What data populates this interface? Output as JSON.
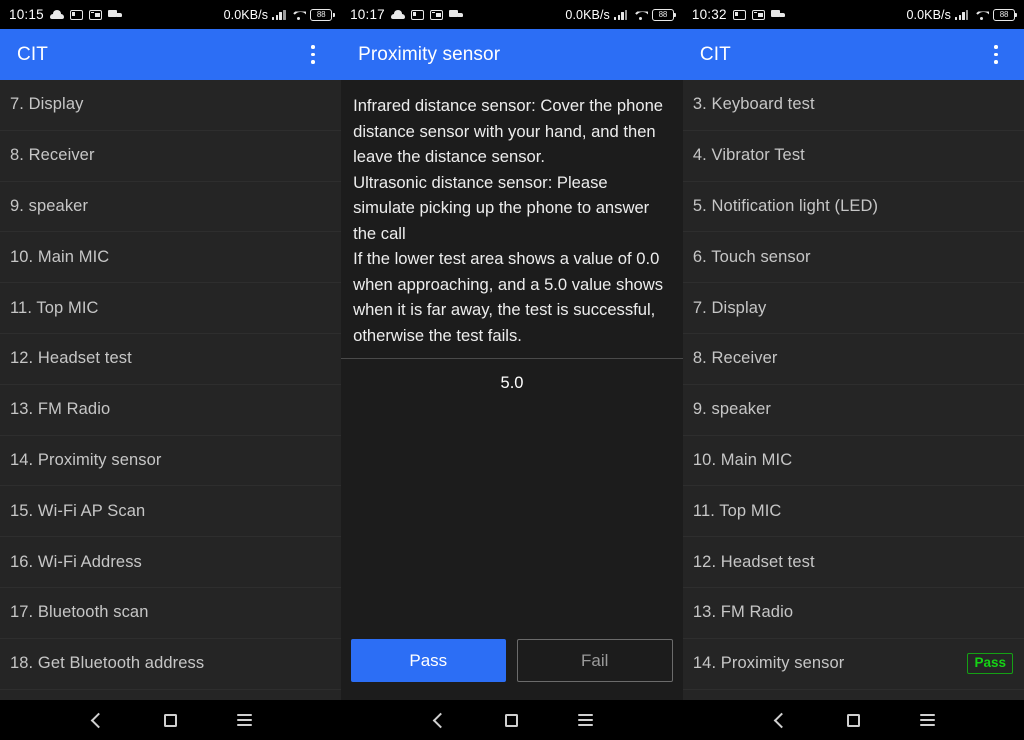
{
  "panels": {
    "left": {
      "statusbar": {
        "time": "10:15",
        "network_speed": "0.0KB/s",
        "battery_level": "88",
        "icons": [
          "cloud-icon",
          "gb-badge-icon",
          "picture-in-picture-icon",
          "truck-icon",
          "signal-bars-icon",
          "wifi-icon",
          "battery-icon"
        ]
      },
      "appbar": {
        "title": "CIT",
        "menu_icon": "overflow-menu-icon"
      },
      "items": [
        {
          "label": "7. Display"
        },
        {
          "label": "8. Receiver"
        },
        {
          "label": "9. speaker"
        },
        {
          "label": "10. Main MIC"
        },
        {
          "label": "11. Top MIC"
        },
        {
          "label": "12. Headset test"
        },
        {
          "label": "13. FM Radio"
        },
        {
          "label": "14. Proximity sensor"
        },
        {
          "label": "15. Wi-Fi AP Scan"
        },
        {
          "label": "16. Wi-Fi Address"
        },
        {
          "label": "17. Bluetooth scan"
        },
        {
          "label": "18. Get Bluetooth address"
        }
      ]
    },
    "mid": {
      "statusbar": {
        "time": "10:17",
        "network_speed": "0.0KB/s",
        "battery_level": "88",
        "icons": [
          "cloud-icon",
          "gb-badge-icon",
          "picture-in-picture-icon",
          "truck-icon",
          "signal-bars-icon",
          "wifi-icon",
          "battery-icon"
        ]
      },
      "appbar": {
        "title": "Proximity sensor"
      },
      "instructions": "Infrared distance sensor: Cover the phone distance sensor with your hand, and then leave the distance sensor.\n Ultrasonic distance sensor: Please simulate picking up the phone to answer the call\n If the lower test area shows a value of 0.0 when approaching, and a 5.0 value shows when it is far away, the test is successful, otherwise the test fails.",
      "sensor_value": "5.0",
      "buttons": {
        "pass": "Pass",
        "fail": "Fail"
      }
    },
    "right": {
      "statusbar": {
        "time": "10:32",
        "network_speed": "0.0KB/s",
        "battery_level": "88",
        "icons": [
          "gb-badge-icon",
          "picture-in-picture-icon",
          "truck-icon",
          "signal-bars-icon",
          "wifi-icon",
          "battery-icon"
        ]
      },
      "appbar": {
        "title": "CIT",
        "menu_icon": "overflow-menu-icon"
      },
      "items": [
        {
          "label": "3. Keyboard test",
          "status": ""
        },
        {
          "label": "4. Vibrator Test",
          "status": ""
        },
        {
          "label": "5. Notification light (LED)",
          "status": ""
        },
        {
          "label": "6. Touch sensor",
          "status": ""
        },
        {
          "label": "7. Display",
          "status": ""
        },
        {
          "label": "8. Receiver",
          "status": ""
        },
        {
          "label": "9. speaker",
          "status": ""
        },
        {
          "label": "10. Main MIC",
          "status": ""
        },
        {
          "label": "11. Top MIC",
          "status": ""
        },
        {
          "label": "12. Headset test",
          "status": ""
        },
        {
          "label": "13. FM Radio",
          "status": ""
        },
        {
          "label": "14. Proximity sensor",
          "status": "Pass"
        }
      ]
    }
  },
  "navbar": {
    "back_icon": "back-chevron-icon",
    "home_icon": "home-square-icon",
    "recents_icon": "recents-menu-icon"
  },
  "colors": {
    "appbar_blue": "#2c6ef5",
    "list_background": "#252525",
    "detail_background": "#1c1c1c",
    "pass_green": "#15d215",
    "text_primary": "#c6c6c6"
  }
}
